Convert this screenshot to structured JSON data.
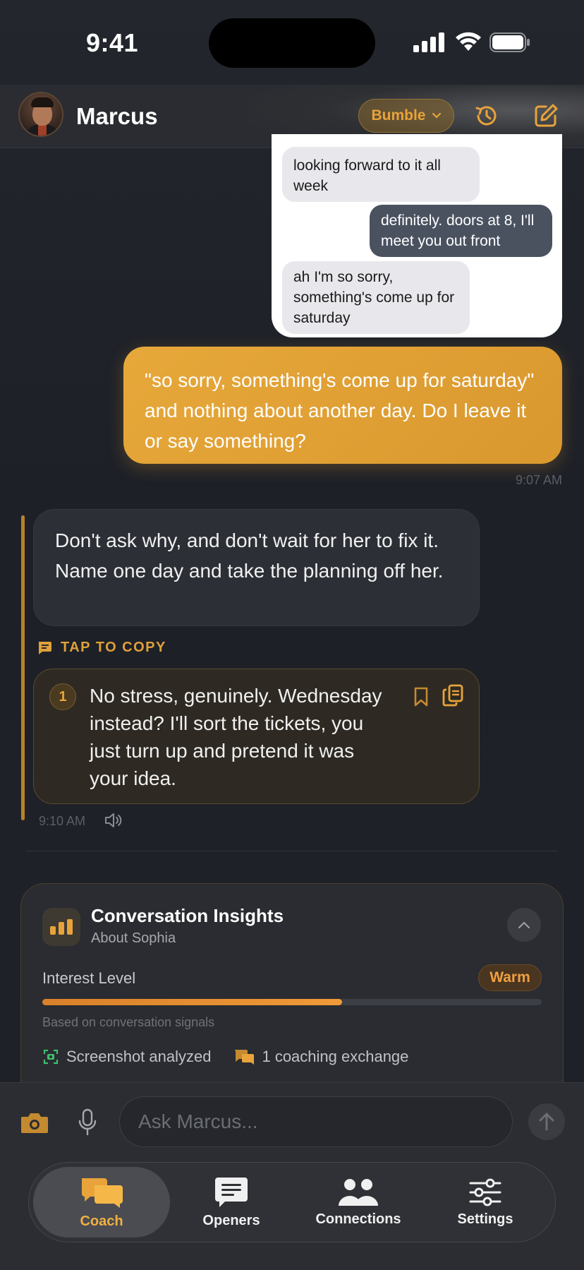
{
  "status_bar": {
    "time": "9:41"
  },
  "header": {
    "name": "Marcus",
    "platform": "Bumble"
  },
  "screenshot": {
    "bubbles": [
      {
        "from": "them",
        "text": "looking forward to it all week"
      },
      {
        "from": "me",
        "text": "definitely. doors at 8, I'll meet you out front"
      },
      {
        "from": "them",
        "text": "ah I'm so sorry, something's come up for saturday"
      }
    ]
  },
  "user_message": {
    "text": "\"so sorry, something's come up for saturday\" and nothing about another day. Do I leave it or say something?",
    "time": "9:07 AM"
  },
  "coach": {
    "message": "Don't ask why, and don't wait for her to fix it. Name one day and take the planning off her.",
    "tap_to_copy": "TAP TO COPY",
    "suggestion": {
      "number": "1",
      "text": "No stress, genuinely. Wednesday instead? I'll sort the tickets, you just turn up and pretend it was your idea."
    },
    "time": "9:10 AM"
  },
  "insights": {
    "title": "Conversation Insights",
    "subtitle": "About Sophia",
    "interest_label": "Interest Level",
    "interest_value": "Warm",
    "interest_fraction": 0.6,
    "based_on": "Based on conversation signals",
    "stats": [
      "Screenshot analyzed",
      "1 coaching exchange"
    ]
  },
  "input": {
    "placeholder": "Ask Marcus..."
  },
  "tabs": [
    {
      "label": "Coach",
      "icon": "coach-bubbles-icon",
      "active": true
    },
    {
      "label": "Openers",
      "icon": "openers-chat-icon",
      "active": false
    },
    {
      "label": "Connections",
      "icon": "people-icon",
      "active": false
    },
    {
      "label": "Settings",
      "icon": "sliders-icon",
      "active": false
    }
  ],
  "colors": {
    "accent": "#E8A33A",
    "background": "#1E2128",
    "surface": "#2C2F35"
  }
}
